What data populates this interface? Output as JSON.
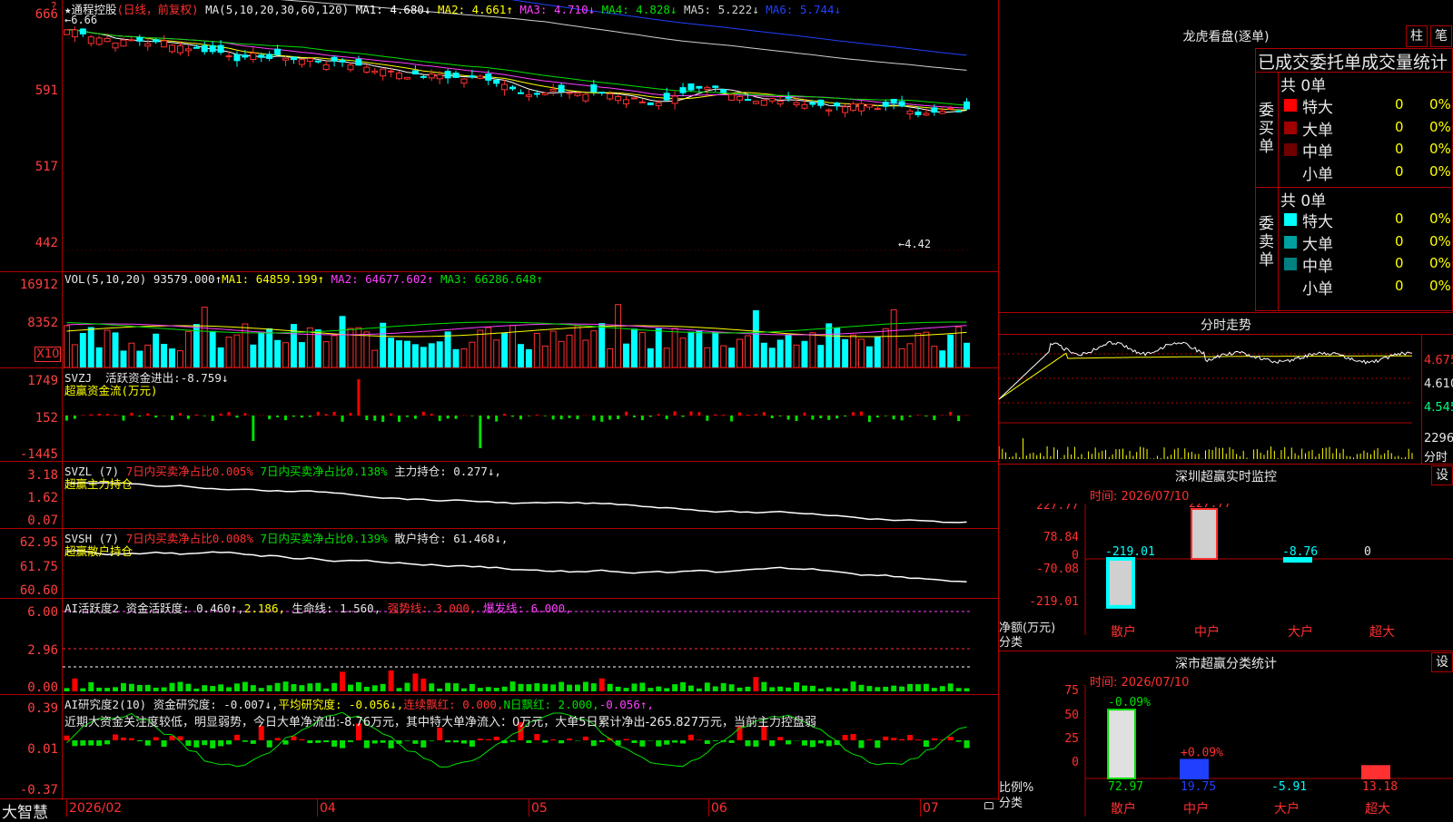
{
  "app": {
    "name": "大智慧"
  },
  "kline": {
    "stock": "★通程控股",
    "mode": "(日线，前复权)",
    "ma_label": "MA(5,10,20,30,60,120)",
    "ma": [
      {
        "name": "MA1:",
        "value": "4.680↓",
        "color": "#ffffff"
      },
      {
        "name": "MA2:",
        "value": "4.661↑",
        "color": "#ffff00"
      },
      {
        "name": "MA3:",
        "value": "4.710↓",
        "color": "#ff40ff"
      },
      {
        "name": "MA4:",
        "value": "4.828↓",
        "color": "#00e000"
      },
      {
        "name": "MA5:",
        "value": "5.222↓",
        "color": "#d0d0d0"
      },
      {
        "name": "MA6:",
        "value": "5.744↓",
        "color": "#2040ff"
      }
    ],
    "y_ticks": [
      "666",
      "591",
      "517",
      "442"
    ],
    "max_label": "←6.66",
    "min_label": "←4.42",
    "colors": {
      "up": "#ff3030",
      "down": "#00ffff"
    }
  },
  "volume": {
    "label": "VOL(5,10,20)",
    "value": "93579.000↑",
    "ma": [
      {
        "name": "MA1:",
        "value": "64859.199↑",
        "color": "#ffff00"
      },
      {
        "name": "MA2:",
        "value": "64677.602↑",
        "color": "#ff40ff"
      },
      {
        "name": "MA3:",
        "value": "66286.648↑",
        "color": "#00e000"
      }
    ],
    "y_ticks": [
      "16912",
      "8352"
    ],
    "unit": "X10"
  },
  "svzj": {
    "label": "SVZJ",
    "text": "活跃资金进出:",
    "value": "-8.759↓",
    "sub": "超赢资金流(万元)",
    "y_ticks": [
      "1749",
      "152",
      "-1445"
    ]
  },
  "svzl": {
    "label": "SVZL (7)",
    "t1": "7日内买卖净占比0.005%",
    "t2": "7日内买卖净占比0.138%",
    "t3": "主力持仓: 0.277↓,",
    "sub": "超赢主力持仓",
    "y_ticks": [
      "3.18",
      "1.62",
      "0.07"
    ]
  },
  "svsh": {
    "label": "SVSH (7)",
    "t1": "7日内买卖净占比0.008%",
    "t2": "7日内买卖净占比0.139%",
    "t3": "散户持仓: 61.468↓,",
    "sub": "超赢散户持仓",
    "y_ticks": [
      "62.95",
      "61.75",
      "60.60"
    ]
  },
  "ai1": {
    "label": "AI活跃度2",
    "t1": "资金活跃度: 0.460↑,",
    "t2": "2.186,",
    "t3": "生命线: 1.560,",
    "t4": "强势线: 3.000,",
    "t5": "爆发线: 6.000,",
    "y_ticks": [
      "6.00",
      "2.96",
      "0.00"
    ]
  },
  "ai2": {
    "label": "AI研究度2(10)",
    "t1": "资金研究度: -0.007↓,",
    "t2": "平均研究度: -0.056↓,",
    "t3": "连续飘红: 0.000,",
    "t4": "N日飘红: 2.000,",
    "t5": "-0.056↑,",
    "comment": "近期大资金关注度较低，明显弱势，今日大单净流出:-8.76万元，其中特大单净流入：0万元，大单5日累计净出-265.827万元，当前主力控盘弱",
    "y_ticks": [
      "0.39",
      "0.01",
      "-0.37"
    ]
  },
  "xaxis": {
    "labels": [
      "2026/02",
      "04",
      "05",
      "06",
      "07"
    ]
  },
  "right": {
    "dragon_title": "龙虎看盘(逐单)",
    "btn1": "柱",
    "btn2": "笔",
    "stat_title": "已成交委托单成交量统计",
    "buy_side": "委买单",
    "sell_side": "委卖单",
    "buy_total": "共 0单",
    "sell_total": "共 0单",
    "buy_rows": [
      {
        "label": "特大",
        "n": "0",
        "p": "0%",
        "color": "#ff0000"
      },
      {
        "label": "大单",
        "n": "0",
        "p": "0%",
        "color": "#a00000"
      },
      {
        "label": "中单",
        "n": "0",
        "p": "0%",
        "color": "#700000"
      },
      {
        "label": "小单",
        "n": "0",
        "p": "0%",
        "color": "#000000"
      }
    ],
    "sell_rows": [
      {
        "label": "特大",
        "n": "0",
        "p": "0%",
        "color": "#00ffff"
      },
      {
        "label": "大单",
        "n": "0",
        "p": "0%",
        "color": "#00a0a0"
      },
      {
        "label": "中单",
        "n": "0",
        "p": "0%",
        "color": "#008080"
      },
      {
        "label": "小单",
        "n": "0",
        "p": "0%",
        "color": "#000000"
      }
    ],
    "intraday_title": "分时走势",
    "intraday_ticks": [
      "4.675",
      "4.610",
      "4.545"
    ],
    "intraday_vol": "2296",
    "intraday_vol_unit": "分时",
    "monitor_title": "深圳超赢实时监控",
    "monitor_btn": "设",
    "monitor_time": "时间: 2026/07/10",
    "monitor_ticks": [
      "227.77",
      "78.84",
      "0",
      "-70.08",
      "-219.01"
    ],
    "monitor_unit": "净额(万元)",
    "monitor_cat": "分类",
    "monitor_bars": [
      {
        "cat": "散户",
        "value": "-219.01",
        "v": -219.01
      },
      {
        "cat": "中户",
        "value": "227.77",
        "v": 227.77
      },
      {
        "cat": "大户",
        "value": "-8.76",
        "v": -8.76
      },
      {
        "cat": "超大",
        "value": "0",
        "v": 0
      }
    ],
    "class_title": "深市超赢分类统计",
    "class_btn": "设",
    "class_time": "时间: 2026/07/10",
    "class_ticks": [
      "75",
      "50",
      "25",
      "0"
    ],
    "class_unit": "比例%",
    "class_cat": "分类",
    "class_bars": [
      {
        "cat": "散户",
        "value": "72.97",
        "top": "-0.09%",
        "v": 72.97,
        "color": "#e0e0e0"
      },
      {
        "cat": "中户",
        "value": "19.75",
        "top": "+0.09%",
        "v": 19.75,
        "color": "#2040ff"
      },
      {
        "cat": "大户",
        "value": "-5.91",
        "top": "",
        "v": 0,
        "color": "#e0e0e0"
      },
      {
        "cat": "超大",
        "value": "13.18",
        "top": "",
        "v": 13.18,
        "color": "#ff3030"
      }
    ]
  }
}
